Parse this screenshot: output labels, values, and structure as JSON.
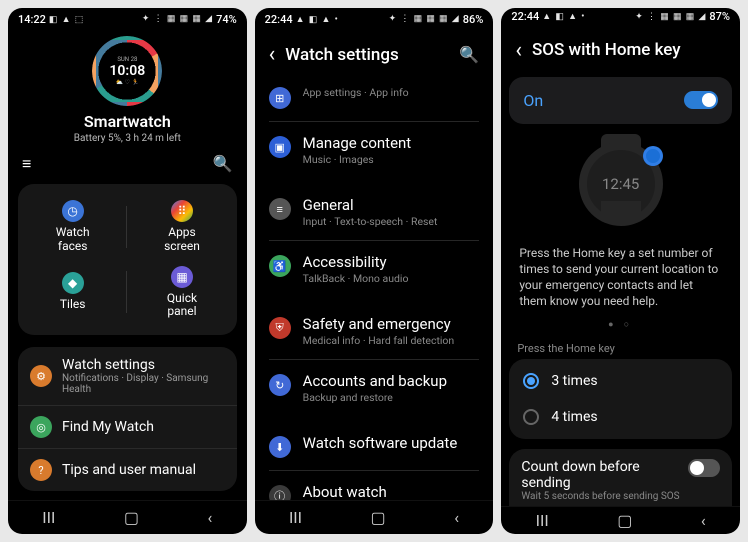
{
  "screen1": {
    "status": {
      "time": "14:22",
      "left_icons": "◧ ▲ ⬚",
      "right_icons": "✦ ⋮ ▦ ▦ ▦ ◢",
      "battery": "74%"
    },
    "watchface": {
      "date": "SUN 28",
      "time": "10:08",
      "bottom": "⛅ ♡ 🏃"
    },
    "device_name": "Smartwatch",
    "battery_line": "Battery 5%, 3 h 24 m left",
    "hamburger": "≡",
    "search": "🔍",
    "tiles": [
      {
        "icon": "◷",
        "label": "Watch\nfaces",
        "color": "ic-blue"
      },
      {
        "icon": "⠿",
        "label": "Apps\nscreen",
        "color": "ic-mix"
      },
      {
        "icon": "◆",
        "label": "Tiles",
        "color": "ic-teal"
      },
      {
        "icon": "▦",
        "label": "Quick\npanel",
        "color": "ic-purple"
      }
    ],
    "settings": [
      {
        "icon": "⚙",
        "title": "Watch settings",
        "sub": "Notifications · Display · Samsung Health",
        "color": "ic-orange"
      },
      {
        "icon": "◎",
        "title": "Find My Watch",
        "sub": "",
        "color": "ic-green"
      },
      {
        "icon": "?",
        "title": "Tips and user manual",
        "sub": "",
        "color": "ic-orange"
      }
    ]
  },
  "screen2": {
    "status": {
      "time": "22:44",
      "left_icons": "▲ ◧ ▲ •",
      "right_icons": "✦ ⋮ ▦ ▦ ▦ ◢",
      "battery": "86%"
    },
    "back": "‹",
    "title": "Watch settings",
    "search": "🔍",
    "items": [
      {
        "icon": "⊞",
        "title": "",
        "sub": "App settings · App info",
        "color": "ic-lblue",
        "group": 0
      },
      {
        "icon": "▣",
        "title": "Manage content",
        "sub": "Music · Images",
        "color": "ic-darkblue",
        "group": 0
      },
      {
        "icon": "≡",
        "title": "General",
        "sub": "Input · Text-to-speech · Reset",
        "color": "ic-grey",
        "group": 1
      },
      {
        "icon": "♿",
        "title": "Accessibility",
        "sub": "TalkBack · Mono audio",
        "color": "ic-green",
        "group": 1
      },
      {
        "icon": "⛨",
        "title": "Safety and emergency",
        "sub": "Medical info · Hard fall detection",
        "color": "ic-red",
        "group": 2
      },
      {
        "icon": "↻",
        "title": "Accounts and backup",
        "sub": "Backup and restore",
        "color": "ic-lblue",
        "group": 2
      },
      {
        "icon": "⬇",
        "title": "Watch software update",
        "sub": "",
        "color": "ic-lblue",
        "group": 3
      },
      {
        "icon": "ⓘ",
        "title": "About watch",
        "sub": "",
        "color": "ic-dgrey",
        "group": 3
      }
    ]
  },
  "screen3": {
    "status": {
      "time": "22:44",
      "left_icons": "▲ ◧ ▲ •",
      "right_icons": "✦ ⋮ ▦ ▦ ▦ ◢",
      "battery": "87%"
    },
    "back": "‹",
    "title": "SOS with Home key",
    "toggle_label": "On",
    "watch_time": "12:45",
    "description": "Press the Home key a set number of times to send your current location to your emergency contacts and let them know you need help.",
    "dots": "● ○",
    "section_label": "Press the Home key",
    "options": [
      {
        "label": "3 times",
        "checked": true
      },
      {
        "label": "4 times",
        "checked": false
      }
    ],
    "countdown": {
      "title": "Count down before sending",
      "sub": "Wait 5 seconds before sending SOS"
    }
  },
  "nav": {
    "recent": "III",
    "home": "▢",
    "back": "‹"
  }
}
